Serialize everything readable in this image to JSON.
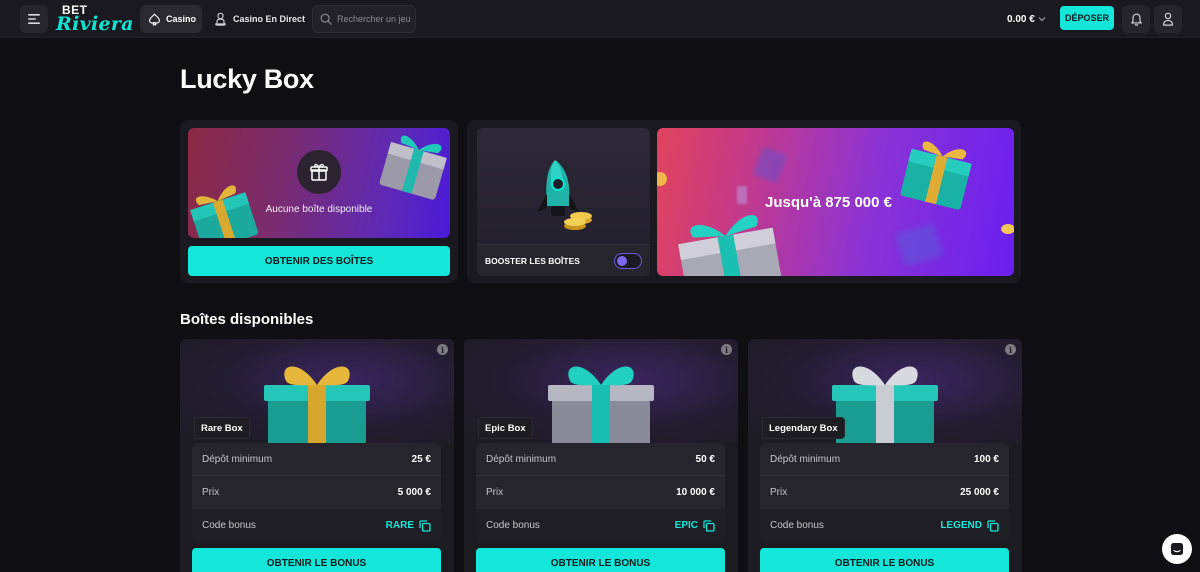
{
  "colors": {
    "accent": "#14e7da",
    "background": "#0f0e13",
    "panel": "#1a1920",
    "card": "#1c1b22"
  },
  "header": {
    "logo_top": "BET",
    "logo_main": "Riviera",
    "nav_casino": "Casino",
    "nav_live": "Casino En Direct",
    "search_placeholder": "Rechercher un jeu",
    "balance": "0.00 €",
    "deposit_label": "DÉPOSER",
    "icons": [
      "menu-icon",
      "casino-spade-icon",
      "dealer-icon",
      "search-icon",
      "chevron-down-icon",
      "bell-icon",
      "user-icon"
    ]
  },
  "page": {
    "title": "Lucky Box",
    "no_box_text": "Aucune boîte disponible",
    "obtain_boxes_label": "OBTENIR DES BOÎTES",
    "booster_label": "BOOSTER LES BOÎTES",
    "booster_enabled": false,
    "jackpot_text": "Jusqu'à 875 000 €",
    "section_title": "Boîtes disponibles"
  },
  "boxes": [
    {
      "name": "Rare Box",
      "min_deposit_label": "Dépôt minimum",
      "min_deposit": "25 €",
      "price_label": "Prix",
      "price": "5 000 €",
      "code_label": "Code bonus",
      "code": "RARE",
      "button": "OBTENIR LE BONUS",
      "ribbon_color": "#d4a72c"
    },
    {
      "name": "Epic Box",
      "min_deposit_label": "Dépôt minimum",
      "min_deposit": "50 €",
      "price_label": "Prix",
      "price": "10 000 €",
      "code_label": "Code bonus",
      "code": "EPIC",
      "button": "OBTENIR LE BONUS",
      "ribbon_color": "#17bfb0"
    },
    {
      "name": "Legendary Box",
      "min_deposit_label": "Dépôt minimum",
      "min_deposit": "100 €",
      "price_label": "Prix",
      "price": "25 000 €",
      "code_label": "Code bonus",
      "code": "LEGEND",
      "button": "OBTENIR LE BONUS",
      "ribbon_color": "#c9cbd2"
    }
  ]
}
